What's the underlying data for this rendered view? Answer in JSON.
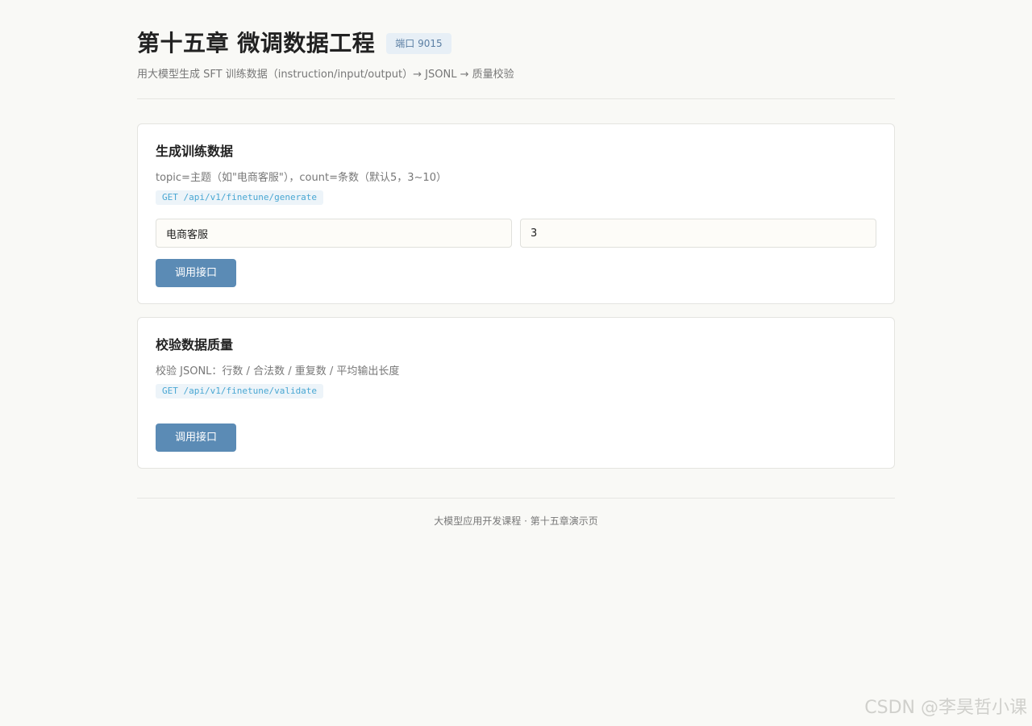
{
  "header": {
    "title": "第十五章 微调数据工程",
    "port_badge": "端口 9015",
    "subtitle": "用大模型生成 SFT 训练数据（instruction/input/output）→ JSONL → 质量校验"
  },
  "cards": [
    {
      "title": "生成训练数据",
      "description": "topic=主题（如\"电商客服\"），count=条数（默认5，3~10）",
      "endpoint": "GET /api/v1/finetune/generate",
      "inputs": {
        "topic_value": "电商客服",
        "count_value": "3"
      },
      "button_label": "调用接口"
    },
    {
      "title": "校验数据质量",
      "description": "校验 JSONL：行数 / 合法数 / 重复数 / 平均输出长度",
      "endpoint": "GET /api/v1/finetune/validate",
      "button_label": "调用接口"
    }
  ],
  "footer": {
    "text": "大模型应用开发课程 · 第十五章演示页"
  },
  "watermark": "CSDN @李昊哲小课",
  "colors": {
    "accent": "#5b8bb5",
    "endpoint_text": "#49a7d3",
    "badge_text": "#5a7ea3",
    "background": "#f9f9f6"
  }
}
